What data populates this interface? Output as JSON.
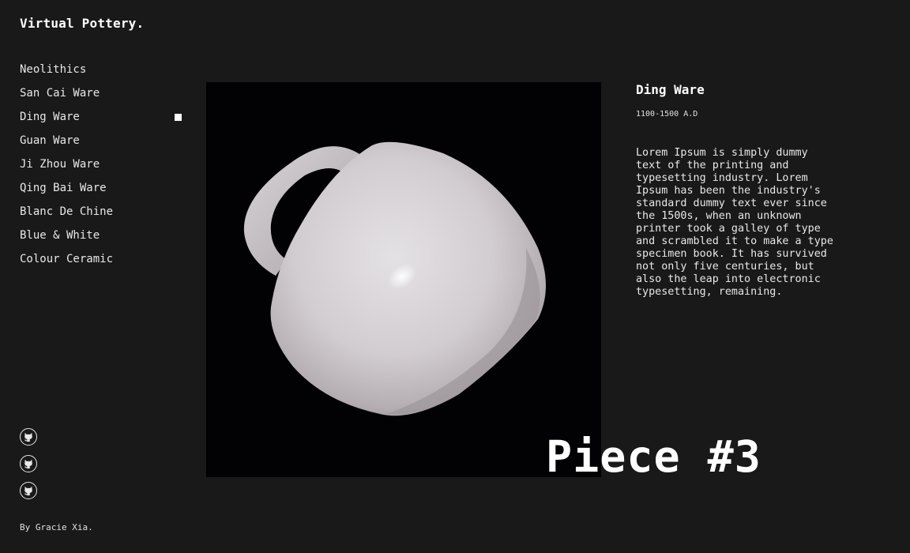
{
  "site": {
    "title": "Virtual Pottery."
  },
  "nav": {
    "items": [
      {
        "label": "Neolithics",
        "active": false
      },
      {
        "label": "San Cai Ware",
        "active": false
      },
      {
        "label": "Ding Ware",
        "active": true
      },
      {
        "label": "Guan Ware",
        "active": false
      },
      {
        "label": "Ji Zhou Ware",
        "active": false
      },
      {
        "label": "Qing Bai Ware",
        "active": false
      },
      {
        "label": "Blanc De Chine",
        "active": false
      },
      {
        "label": "Blue & White",
        "active": false
      },
      {
        "label": "Colour Ceramic",
        "active": false
      }
    ]
  },
  "socials": {
    "icons": [
      "github-icon",
      "github-icon",
      "github-icon"
    ]
  },
  "footer": {
    "credit": "By Gracie Xia."
  },
  "piece": {
    "title": "Ding Ware",
    "date": "1100-1500 A.D",
    "description": "Lorem Ipsum is simply dummy\ntext of the printing and\ntypesetting industry. Lorem\nIpsum has been the industry's\nstandard dummy text ever since\nthe 1500s, when an unknown\nprinter took a galley of type\nand scrambled it to make a type\nspecimen book. It has survived\nnot only five centuries, but\nalso the leap into electronic\ntypesetting, remaining.",
    "number_label": "Piece #3"
  },
  "colors": {
    "background": "#191919",
    "viewer_bg": "#020103",
    "accent": "#ffffff",
    "mug": "#d2cdd0"
  }
}
